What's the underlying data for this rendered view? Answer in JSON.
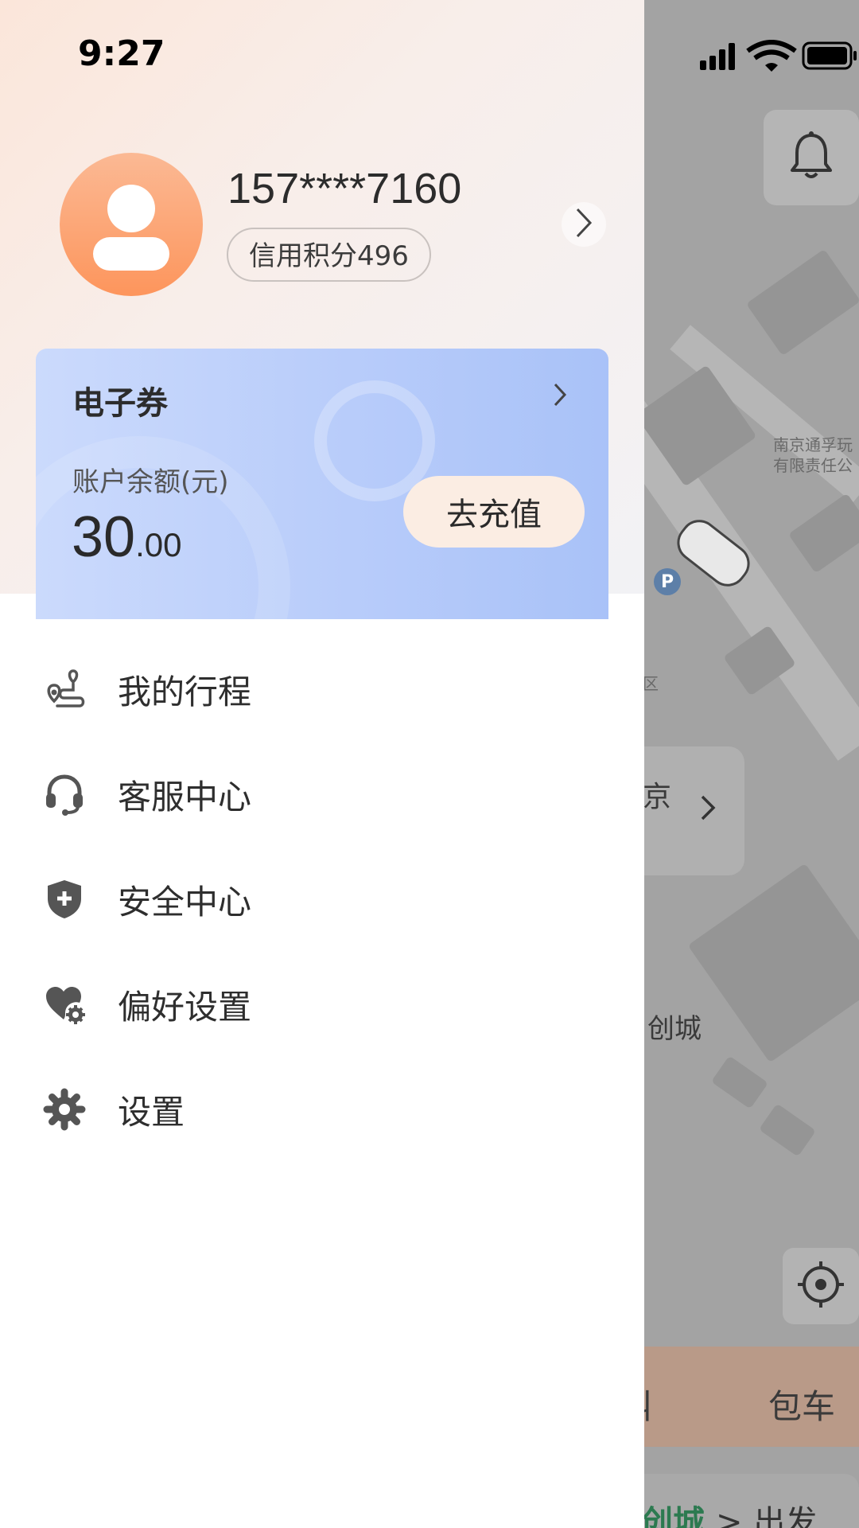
{
  "status_bar": {
    "time": "9:27"
  },
  "profile": {
    "phone": "157****7160",
    "credit": "信用积分496"
  },
  "wallet": {
    "title": "电子券",
    "balance_label": "账户余额(元)",
    "balance_int": "30",
    "balance_dec": ".00",
    "recharge_label": "去充值"
  },
  "menu": {
    "items": [
      {
        "label": "我的行程",
        "icon": "route-icon"
      },
      {
        "label": "客服中心",
        "icon": "headset-icon"
      },
      {
        "label": "安全中心",
        "icon": "shield-icon"
      },
      {
        "label": "偏好设置",
        "icon": "heart-gear-icon"
      },
      {
        "label": "设置",
        "icon": "gear-icon"
      }
    ]
  },
  "map": {
    "poi_label_1": "南京通孚玩",
    "poi_label_2": "有限责任公",
    "area_label": "区",
    "place_label": "创城",
    "parking": "P",
    "card_text": "京",
    "bottom_tab_a": "叫",
    "bottom_tab_b": "包车",
    "dest_text": "创城",
    "dest_sep": ">",
    "dest_action": "出发"
  },
  "colors": {
    "avatar_gradient_top": "#fbb994",
    "avatar_gradient_bottom": "#fd955c",
    "wallet_blue": "#b8ccfa",
    "recharge_bg": "#fbede3",
    "dest_green": "#2c7a50"
  }
}
